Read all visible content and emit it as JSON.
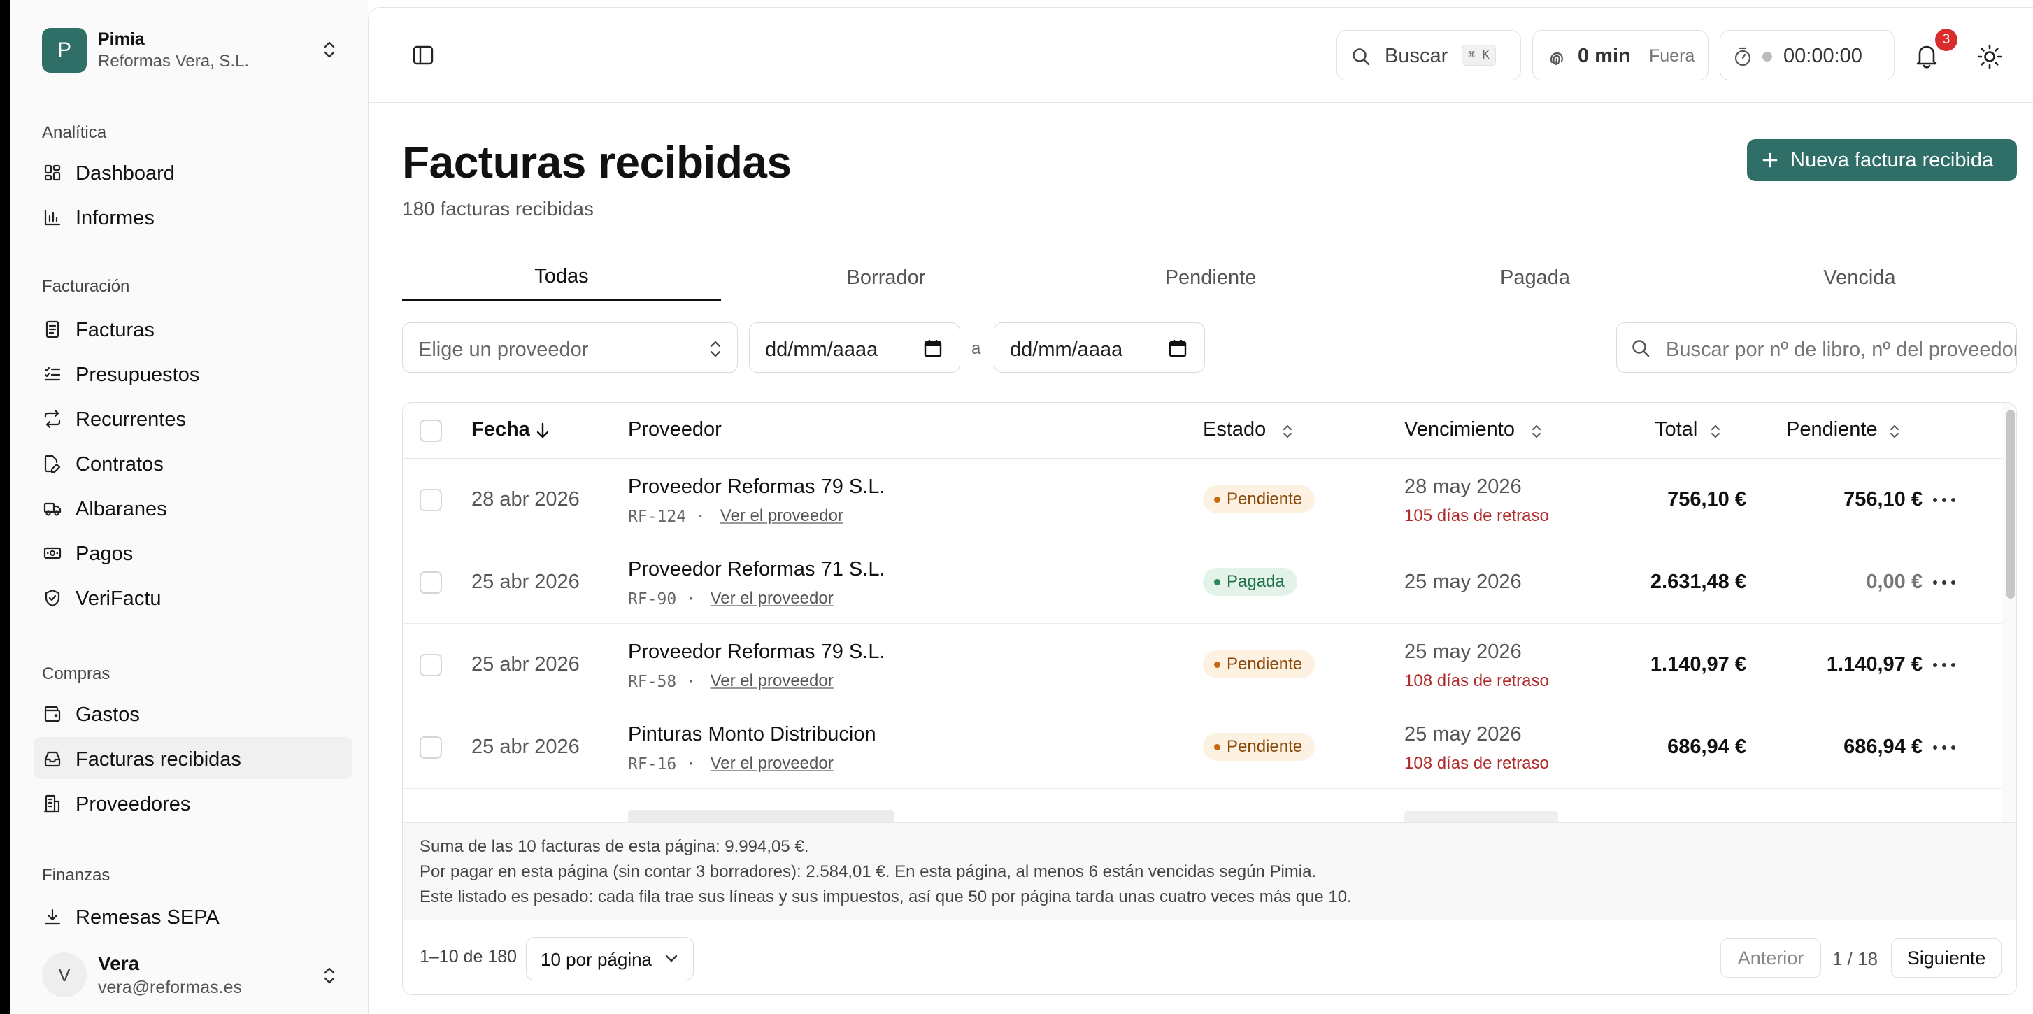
{
  "org": {
    "initial": "P",
    "name": "Pimia",
    "company": "Reformas Vera, S.L."
  },
  "nav": {
    "sections": [
      {
        "label": "Analítica",
        "items": [
          {
            "label": "Dashboard",
            "icon": "dashboard-icon"
          },
          {
            "label": "Informes",
            "icon": "bar-chart-icon"
          }
        ]
      },
      {
        "label": "Facturación",
        "items": [
          {
            "label": "Facturas",
            "icon": "document-icon"
          },
          {
            "label": "Presupuestos",
            "icon": "checklist-icon"
          },
          {
            "label": "Recurrentes",
            "icon": "repeat-icon"
          },
          {
            "label": "Contratos",
            "icon": "file-pen-icon"
          },
          {
            "label": "Albaranes",
            "icon": "truck-icon"
          },
          {
            "label": "Pagos",
            "icon": "banknote-icon"
          },
          {
            "label": "VeriFactu",
            "icon": "shield-check-icon"
          }
        ]
      },
      {
        "label": "Compras",
        "items": [
          {
            "label": "Gastos",
            "icon": "wallet-icon"
          },
          {
            "label": "Facturas recibidas",
            "icon": "inbox-icon",
            "active": true
          },
          {
            "label": "Proveedores",
            "icon": "building-icon"
          }
        ]
      },
      {
        "label": "Finanzas",
        "items": [
          {
            "label": "Remesas SEPA",
            "icon": "download-icon"
          }
        ]
      }
    ]
  },
  "user": {
    "initial": "V",
    "name": "Vera",
    "email": "vera@reformas.es"
  },
  "topbar": {
    "search_label": "Buscar",
    "search_shortcut": "⌘ K",
    "time_value": "0 min",
    "time_status": "Fuera",
    "timer": "00:00:00",
    "notifications_count": "3"
  },
  "page": {
    "title": "Facturas recibidas",
    "subtitle": "180 facturas recibidas",
    "new_button": "Nueva factura recibida"
  },
  "tabs": [
    "Todas",
    "Borrador",
    "Pendiente",
    "Pagada",
    "Vencida"
  ],
  "active_tab": 0,
  "filters": {
    "provider_placeholder": "Elige un proveedor",
    "date_from": "dd/mm/aaaa",
    "date_sep": "a",
    "date_to": "dd/mm/aaaa",
    "search_placeholder": "Buscar por nº de libro, nº del proveedor"
  },
  "table": {
    "columns": {
      "fecha": "Fecha",
      "proveedor": "Proveedor",
      "estado": "Estado",
      "vencimiento": "Vencimiento",
      "total": "Total",
      "pendiente": "Pendiente"
    },
    "link_label": "Ver el proveedor",
    "rows": [
      {
        "fecha": "28 abr 2026",
        "proveedor": "Proveedor Reformas 79 S.L.",
        "ref": "RF-124",
        "estado": "Pendiente",
        "estado_kind": "pend",
        "vencimiento": "28 may 2026",
        "retraso": "105 días de retraso",
        "total": "756,10 €",
        "pendiente": "756,10 €"
      },
      {
        "fecha": "25 abr 2026",
        "proveedor": "Proveedor Reformas 71 S.L.",
        "ref": "RF-90",
        "estado": "Pagada",
        "estado_kind": "paid",
        "vencimiento": "25 may 2026",
        "retraso": "",
        "total": "2.631,48 €",
        "pendiente": "0,00 €"
      },
      {
        "fecha": "25 abr 2026",
        "proveedor": "Proveedor Reformas 79 S.L.",
        "ref": "RF-58",
        "estado": "Pendiente",
        "estado_kind": "pend",
        "vencimiento": "25 may 2026",
        "retraso": "108 días de retraso",
        "total": "1.140,97 €",
        "pendiente": "1.140,97 €"
      },
      {
        "fecha": "25 abr 2026",
        "proveedor": "Pinturas Monto Distribucion",
        "ref": "RF-16",
        "estado": "Pendiente",
        "estado_kind": "pend",
        "vencimiento": "25 may 2026",
        "retraso": "108 días de retraso",
        "total": "686,94 €",
        "pendiente": "686,94 €"
      }
    ]
  },
  "summary": [
    "Suma de las 10 facturas de esta página: 9.994,05 €.",
    "Por pagar en esta página (sin contar 3 borradores): 2.584,01 €. En esta página, al menos 6 están vencidas según Pimia.",
    "Este listado es pesado: cada fila trae sus líneas y sus impuestos, así que 50 por página tarda unas cuatro veces más que 10."
  ],
  "pager": {
    "count": "1–10 de 180",
    "per_page": "10 por página",
    "prev": "Anterior",
    "page": "1 / 18",
    "next": "Siguiente"
  }
}
